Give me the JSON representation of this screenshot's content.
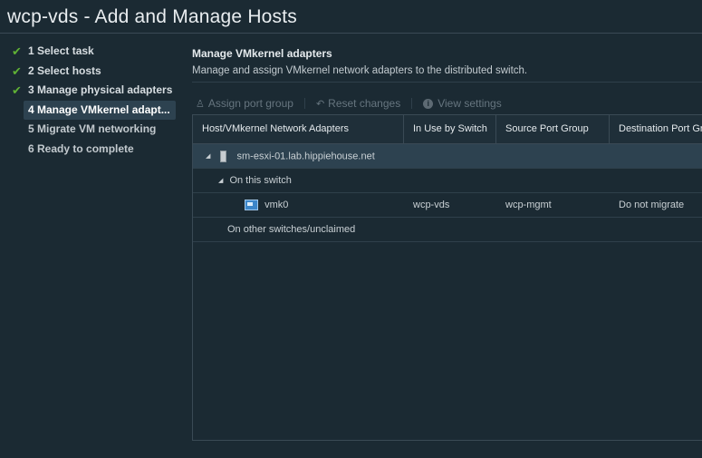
{
  "dialog": {
    "title": "wcp-vds - Add and Manage Hosts"
  },
  "steps": [
    {
      "label": "1 Select task",
      "state": "done"
    },
    {
      "label": "2 Select hosts",
      "state": "done"
    },
    {
      "label": "3 Manage physical adapters",
      "state": "done"
    },
    {
      "label": "4 Manage VMkernel adapt...",
      "state": "active"
    },
    {
      "label": "5 Migrate VM networking",
      "state": "future"
    },
    {
      "label": "6 Ready to complete",
      "state": "future"
    }
  ],
  "main": {
    "title": "Manage VMkernel adapters",
    "description": "Manage and assign VMkernel network adapters to the distributed switch."
  },
  "toolbar": {
    "assign_label": "Assign port group",
    "reset_label": "Reset changes",
    "view_label": "View settings"
  },
  "grid": {
    "columns": [
      "Host/VMkernel Network Adapters",
      "In Use by Switch",
      "Source Port Group",
      "Destination Port Group"
    ],
    "host": "sm-esxi-01.lab.hippiehouse.net",
    "on_this_switch": "On this switch",
    "adapter": {
      "name": "vmk0",
      "in_use_by_switch": "wcp-vds",
      "source_port_group": "wcp-mgmt",
      "destination_port_group": "Do not migrate"
    },
    "on_other_switches": "On other switches/unclaimed"
  },
  "colors": {
    "background": "#1b2a33",
    "selected": "#2d4250",
    "check": "#5fb135",
    "border": "#3a4a55"
  }
}
